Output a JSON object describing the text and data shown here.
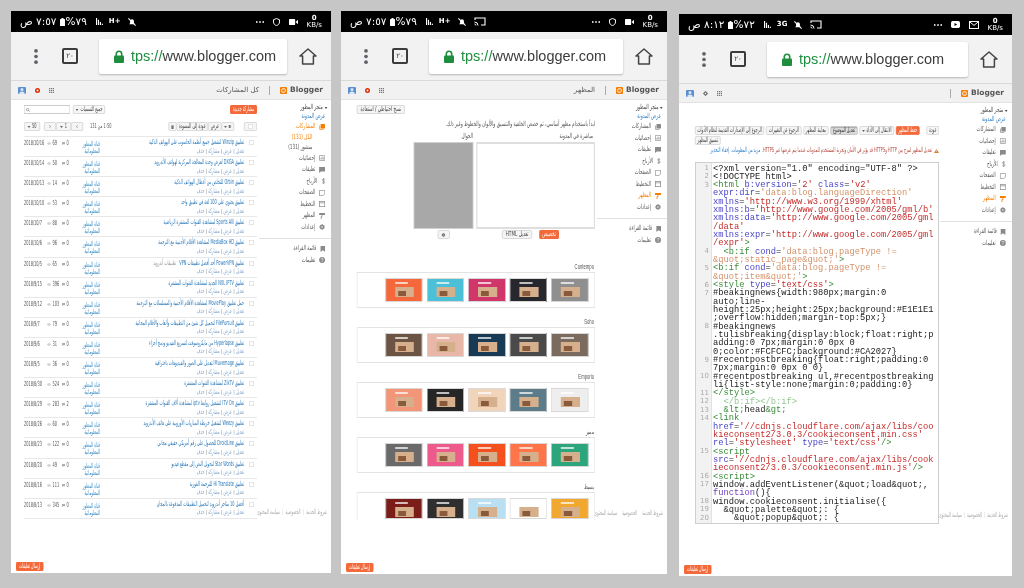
{
  "screens": [
    {
      "kind": "html_editor",
      "status_bar": {
        "time": "٨:١٢ ص",
        "battery": "%٧٢",
        "network": "3G",
        "icons": [
          {
            "kind": "cast"
          },
          {
            "kind": "mute"
          }
        ],
        "notifications": [
          {
            "kind": "mail"
          },
          {
            "kind": "play"
          },
          {
            "kind": "more"
          }
        ],
        "speed": "0",
        "speed_unit": "KB/s"
      },
      "browser": {
        "tab_count": "٢٠",
        "url_scheme": "tps://",
        "url_host": "www.blogger.com"
      },
      "app_header": {
        "brand": "Blogger",
        "account_icons": [
          {
            "kind": "apps"
          },
          {
            "kind": "settings"
          },
          {
            "kind": "avatar"
          }
        ]
      },
      "sidebar": {
        "blog_name": "متجر المطور",
        "view_blog": "عرض المدونة",
        "items": [
          {
            "label": "المشاركات",
            "selected": false
          },
          {
            "label": "إحصائيات",
            "selected": false
          },
          {
            "label": "تعليقات",
            "selected": false
          },
          {
            "label": "الأرباح",
            "selected": false
          },
          {
            "label": "الصفحات",
            "selected": false
          },
          {
            "label": "التخطيط",
            "selected": false
          },
          {
            "label": "المظهر",
            "selected": true
          },
          {
            "label": "إعدادات",
            "selected": false
          }
        ],
        "secondary_items": [
          "قائمة القراءة",
          "تعليمات"
        ]
      },
      "editor": {
        "toolbar_rows": [
          [
            {
              "label": "عودة",
              "kind": "default"
            },
            {
              "label": "حفظ المظهر",
              "kind": "primary"
            },
            {
              "label": "الانتقال إلى الأداة",
              "kind": "dropdown"
            },
            {
              "label": "تعديل الموضوع",
              "kind": "pressed"
            },
            {
              "label": "معاينة المظهر",
              "kind": "default"
            },
            {
              "label": "الرجوع عن التغييرات",
              "kind": "default"
            },
            {
              "label": "الرجوع إلى الإصدارات القديمة لنظام الأدوات",
              "kind": "default"
            }
          ],
          [
            {
              "label": "تنسيق المظهر",
              "kind": "default"
            }
          ]
        ],
        "warning": {
          "text": "تعديل المظهر لمزج بين HTTP وHTTPS قد يؤثر في الأمان وتجربة المستخدم للمدونات عندما يتم عرضها عبر HTTPS.",
          "links": [
            "مزيد من المعلومات.",
            "إخفاء التحذير"
          ]
        },
        "code_lines": [
          {
            "number": "1",
            "kind": "plain",
            "text": "<?xml version=\"1.0\" encoding=\"UTF-8\" ?>"
          },
          {
            "number": "2",
            "kind": "plain",
            "text": "<!DOCTYPE html>"
          },
          {
            "number": "3",
            "kind": "markup",
            "text": "<html b:version='2' class='v2' expr:dir='data:blog.languageDirection' xmlns='http://www.w3.org/1999/xhtml' xmlns:b='http://www.google.com/2005/gml/b' xmlns:data='http://www.google.com/2005/gml/data' xmlns:expr='http://www.google.com/2005/gml/expr'>"
          },
          {
            "number": "4",
            "kind": "markup",
            "text": "  <b:if cond='data:blog.pageType != &quot;static_page&quot;'>"
          },
          {
            "number": "5",
            "kind": "markup",
            "text": "<b:if cond='data:blog.pageType != &quot;item&quot;'>"
          },
          {
            "number": "6",
            "kind": "markup",
            "text": "<style type='text/css'>"
          },
          {
            "number": "7",
            "kind": "plain",
            "text": "#beakingnews{width:980px;margin:0 auto;line-height:25px;height:25px;background:#E1E1E1;overflow:hidden;margin-top:5px;}"
          },
          {
            "number": "8",
            "kind": "plain",
            "text": "#beakingnews .tulisbreaking{display:block;float:right;padding:0 7px;margin:0 0px 0 0;color:#FCFCFC;background:#CA2027}"
          },
          {
            "number": "9",
            "kind": "plain",
            "text": "#recentpostbreaking{float:right;padding:0 7px;margin:0 0px 0 0}"
          },
          {
            "number": "10",
            "kind": "plain",
            "text": "#recentpostbreaking ul,#recentpostbreaking li{list-style:none;margin:0;padding:0}"
          },
          {
            "number": "11",
            "kind": "markup",
            "text": "</style>"
          },
          {
            "number": "12",
            "kind": "dim",
            "text": "  </b:if></b:if>"
          },
          {
            "number": "13",
            "kind": "markup",
            "text": "  &lt;head&gt;"
          },
          {
            "number": "14",
            "kind": "markup",
            "text": "<link href='//cdnjs.cloudflare.com/ajax/libs/cookieconsent2/3.0.3/cookieconsent.min.css' rel='stylesheet' type='text/css'/>"
          },
          {
            "number": "15",
            "kind": "markup",
            "text": "<script src='//cdnjs.cloudflare.com/ajax/libs/cookieconsent2/3.0.3/cookieconsent.min.js'/>"
          },
          {
            "number": "16",
            "kind": "markup",
            "text": "<script>"
          },
          {
            "number": "17",
            "kind": "script",
            "text": "window.addEventListener(&quot;load&quot;, function(){"
          },
          {
            "number": "18",
            "kind": "plain",
            "text": "window.cookieconsent.initialise({"
          },
          {
            "number": "19",
            "kind": "plain",
            "text": "  &quot;palette&quot;: {"
          },
          {
            "number": "20",
            "kind": "plain",
            "text": "    &quot;popup&quot;: {"
          }
        ]
      },
      "footer_links": [
        "شروط الخدمة",
        "الخصوصية",
        "سياسة المحتوى"
      ],
      "feedback_button": "إرسال تعليقات"
    },
    {
      "kind": "theme",
      "status_bar": {
        "time": "٧:٥٧ ص",
        "battery": "%٧٩",
        "network": "H+",
        "icons": [
          {
            "kind": "cast"
          },
          {
            "kind": "mute"
          }
        ],
        "notifications": [
          {
            "kind": "video"
          },
          {
            "kind": "shield"
          },
          {
            "kind": "more"
          }
        ],
        "speed": "0",
        "speed_unit": "KB/s"
      },
      "browser": {
        "tab_count": "٢٠",
        "url_scheme": "tps://",
        "url_host": "www.blogger.com"
      },
      "app_header": {
        "brand": "Blogger",
        "page_title": "المظهر",
        "account_icons": [
          {
            "kind": "apps"
          },
          {
            "kind": "alert"
          },
          {
            "kind": "avatar"
          }
        ]
      },
      "sidebar": {
        "blog_name": "متجر المطور",
        "view_blog": "عرض المدونة",
        "items": [
          {
            "label": "المشاركات",
            "selected": false
          },
          {
            "label": "إحصائيات",
            "selected": false
          },
          {
            "label": "تعليقات",
            "selected": false
          },
          {
            "label": "الأرباح",
            "selected": false
          },
          {
            "label": "الصفحات",
            "selected": false
          },
          {
            "label": "التخطيط",
            "selected": false
          },
          {
            "label": "المظهر",
            "selected": true
          },
          {
            "label": "إعدادات",
            "selected": false
          }
        ],
        "secondary_items": [
          "قائمة القراءة",
          "تعليمات"
        ]
      },
      "theme": {
        "backup_button": "نسخ احتياطي / استعادة",
        "intro": "ابدأ باستخدام مظهر أساسي، ثم خصص الخلفية والتنسيق والألوان والخطوط وغير ذلك.",
        "live_label": "مباشرة في المدونة",
        "mobile_label": "الجوال",
        "customize_button": "تخصيص",
        "edit_html_button": "تعديل HTML",
        "groups": [
          {
            "name": "Contempo",
            "thumbnails": [
              {
                "color": "#8f8f8f"
              },
              {
                "color": "#27272e"
              },
              {
                "color": "#d1366b"
              },
              {
                "color": "#4cc0d6"
              },
              {
                "color": "#f4683c"
              }
            ]
          },
          {
            "name": "Soho",
            "thumbnails": [
              {
                "color": "#7b6a5e"
              },
              {
                "color": "#4a4a4a"
              },
              {
                "color": "#183a55"
              },
              {
                "color": "#e8b7a8"
              },
              {
                "color": "#6b5444"
              }
            ]
          },
          {
            "name": "Emporio",
            "thumbnails": [
              {
                "color": "#eeeeee"
              },
              {
                "color": "#5d7c8a"
              },
              {
                "color": "#f0d5bb"
              },
              {
                "color": "#262626"
              },
              {
                "color": "#f29578"
              }
            ]
          },
          {
            "name": "مميز",
            "thumbnails": [
              {
                "color": "#2ca57c"
              },
              {
                "color": "#ff7448"
              },
              {
                "color": "#f4511e"
              },
              {
                "color": "#ef5a8d"
              },
              {
                "color": "#6a6a6a"
              }
            ]
          },
          {
            "name": "بسيط",
            "thumbnails": [
              {
                "color": "#f0a830"
              },
              {
                "color": "#ffffff"
              },
              {
                "color": "#b9dff2"
              },
              {
                "color": "#2f2f2f"
              },
              {
                "color": "#7b1e1a"
              }
            ]
          }
        ]
      },
      "footer_links": [
        "شروط الخدمة",
        "الخصوصية",
        "سياسة المحتوى"
      ],
      "feedback_button": "إرسال تعليقات"
    },
    {
      "kind": "posts",
      "status_bar": {
        "time": "٧:٥٧ ص",
        "battery": "%٧٩",
        "network": "H+",
        "icons": [
          {
            "kind": "mute"
          }
        ],
        "notifications": [
          {
            "kind": "video"
          },
          {
            "kind": "shield"
          },
          {
            "kind": "more"
          }
        ],
        "speed": "0",
        "speed_unit": "KB/s"
      },
      "browser": {
        "tab_count": "٢٠",
        "url_scheme": "tps://",
        "url_host": "www.blogger.com"
      },
      "app_header": {
        "brand": "Blogger",
        "page_title": "كل المشاركات",
        "account_icons": [
          {
            "kind": "apps"
          },
          {
            "kind": "alert"
          },
          {
            "kind": "avatar"
          }
        ]
      },
      "sidebar": {
        "blog_name": "متجر المطور",
        "view_blog": "عرض المدونة",
        "items": [
          {
            "label": "المشاركات",
            "selected": true,
            "children": [
              {
                "label": "الكل (131)",
                "selected": true
              },
              {
                "label": "منشور (131)",
                "selected": false
              }
            ]
          },
          {
            "label": "إحصائيات",
            "selected": false
          },
          {
            "label": "تعليقات",
            "selected": false
          },
          {
            "label": "الأرباح",
            "selected": false
          },
          {
            "label": "الصفحات",
            "selected": false
          },
          {
            "label": "التخطيط",
            "selected": false
          },
          {
            "label": "المظهر",
            "selected": false
          },
          {
            "label": "إعدادات",
            "selected": false
          }
        ],
        "secondary_items": [
          "قائمة القراءة",
          "تعليمات"
        ]
      },
      "posts": {
        "new_post_button": "مشاركة جديدة",
        "label_filter": "جميع التسميات",
        "select_all_checked": false,
        "actions": [
          "عرض",
          "عودة إلى المسودة"
        ],
        "range": "1-50 من 131",
        "page": "1",
        "page_size": "50",
        "rows": [
          {
            "checked": false,
            "title": "تطبيق Winzip لتشغيل جميع أنظمة الحاسوب على الهواتف الذكية",
            "actions": [
              "تعديل",
              "عرض",
              "مشاركة",
              "حذف"
            ],
            "author": "قناة المطور المعلوماتية",
            "comments": "0",
            "views": "69",
            "date": "2018/10/16"
          },
          {
            "checked": false,
            "title": "تطبيق DXGA لعرض وحدة المعالجة المركزية لهواتف الأندرويد",
            "actions": [
              "تعديل",
              "عرض",
              "مشاركة",
              "حذف"
            ],
            "author": "قناة المطور المعلوماتية",
            "comments": "0",
            "views": "50",
            "date": "2018/10/14"
          },
          {
            "checked": false,
            "title": "تطبيق Orbin للتخلص من أعطال الهواتف الذكية",
            "actions": [
              "تعديل",
              "عرض",
              "مشاركة",
              "حذف"
            ],
            "author": "قناة المطور المعلوماتية",
            "comments": "0",
            "views": "14",
            "date": "2018/10/13"
          },
          {
            "checked": false,
            "title": "تطبيق يحتوي على 100 لغة في تطبيق واحد",
            "actions": [
              "تعديل",
              "عرض",
              "مشاركة",
              "حذف"
            ],
            "author": "قناة المطور المعلوماتية",
            "comments": "0",
            "views": "53",
            "date": "2018/10/10"
          },
          {
            "checked": false,
            "title": "تطبيق Sports Alli لمشاهدة القنوات المشفرة الرياضية",
            "actions": [
              "تعديل",
              "عرض",
              "مشاركة",
              "حذف"
            ],
            "author": "قناة المطور المعلوماتية",
            "comments": "0",
            "views": "88",
            "date": "2018/10/7"
          },
          {
            "checked": false,
            "title": "تطبيق MediaBox HD لمشاهدة الأفلام الأجنبية مع الترجمة",
            "actions": [
              "تعديل",
              "عرض",
              "مشاركة",
              "حذف"
            ],
            "author": "قناة المطور المعلوماتية",
            "comments": "0",
            "views": "96",
            "date": "2018/10/6"
          },
          {
            "checked": false,
            "title": "تطبيق PowerVPN أحد أفضل تطبيقات VPN",
            "label": "تطبيقات أندرويد",
            "actions": [
              "تعديل",
              "عرض",
              "مشاركة",
              "حذف"
            ],
            "author": "قناة المطور المعلوماتية",
            "comments": "0",
            "views": "65",
            "date": "2018/10/5"
          },
          {
            "checked": false,
            "title": "تطبيق NXL IPTV الجديد لمشاهدة القنوات المشفرة",
            "actions": [
              "تعديل",
              "عرض",
              "مشاركة",
              "حذف"
            ],
            "author": "قناة المطور المعلوماتية",
            "comments": "0",
            "views": "396",
            "date": "2018/9/15"
          },
          {
            "checked": false,
            "title": "حمل تطبيق MoviePlay لمشاهدة الأفلام الأجنبية والمسلسلات مع الترجمة",
            "actions": [
              "تعديل",
              "عرض",
              "مشاركة",
              "حذف"
            ],
            "author": "قناة المطور المعلوماتية",
            "comments": "0",
            "views": "103",
            "date": "2018/9/12"
          },
          {
            "checked": false,
            "title": "تطبيق FilePursuit لتحميل كل شيئ من التطبيقات وألعاب والأفلام المجانية",
            "actions": [
              "تعديل",
              "عرض",
              "مشاركة",
              "حذف"
            ],
            "author": "قناة المطور المعلوماتية",
            "comments": "0",
            "views": "79",
            "date": "2018/9/7"
          },
          {
            "checked": false,
            "title": "تطبيق Hyperlapse من مايكروسوفت لتسريع الفيديو ودمج أجزاء",
            "actions": [
              "تعديل",
              "عرض",
              "مشاركة",
              "حذف"
            ],
            "author": "قناة المطور المعلوماتية",
            "comments": "0",
            "views": "31",
            "date": "2018/9/6"
          },
          {
            "checked": false,
            "title": "تطبيق Muvemage لتعديل على الصور والفيديوهات باحترافية",
            "actions": [
              "تعديل",
              "عرض",
              "مشاركة",
              "حذف"
            ],
            "author": "قناة المطور المعلوماتية",
            "comments": "0",
            "views": "36",
            "date": "2018/9/5"
          },
          {
            "checked": false,
            "title": "تطبيق ZikTV لمشاهدة القنوات المشفرة",
            "actions": [
              "تعديل",
              "عرض",
              "مشاركة",
              "حذف"
            ],
            "author": "قناة المطور المعلوماتية",
            "comments": "0",
            "views": "524",
            "date": "2018/8/30"
          },
          {
            "checked": false,
            "title": "تطبيق ITV On لتشغيل روابط iptv لمشاهدة آلاف القنوات المشفرة",
            "actions": [
              "تعديل",
              "عرض",
              "مشاركة",
              "حذف"
            ],
            "author": "قناة المطور المعلوماتية",
            "comments": "2",
            "views": "283",
            "date": "2018/8/29"
          },
          {
            "checked": false,
            "title": "تطبيق Weezy لتشغيل خريطة المباريات الأوروبية على هاتف الأندرويد",
            "actions": [
              "تعديل",
              "عرض",
              "مشاركة",
              "حذف"
            ],
            "author": "قناة المطور المعلوماتية",
            "comments": "0",
            "views": "60",
            "date": "2018/8/26"
          },
          {
            "checked": false,
            "title": "تطبيق DroidLine للحصول على رقم أمريكي حقيقي مجاني",
            "actions": [
              "تعديل",
              "عرض",
              "مشاركة",
              "حذف"
            ],
            "author": "قناة المطور المعلوماتية",
            "comments": "0",
            "views": "122",
            "date": "2018/8/23"
          },
          {
            "checked": false,
            "title": "تطبيق Star Words لتحويل النص إلى مقطع فيديو",
            "actions": [
              "تعديل",
              "عرض",
              "مشاركة",
              "حذف"
            ],
            "author": "قناة المطور المعلوماتية",
            "comments": "0",
            "views": "49",
            "date": "2018/8/20"
          },
          {
            "checked": false,
            "title": "تطبيق Hi Translate للترجمة الفورية",
            "actions": [
              "تعديل",
              "عرض",
              "مشاركة",
              "حذف"
            ],
            "author": "قناة المطور المعلوماتية",
            "comments": "0",
            "views": "111",
            "date": "2018/8/16"
          },
          {
            "checked": false,
            "title": "أفضل 10 متاجر أندرويد لتحميل التطبيقات المدفوعة بالمجان",
            "actions": [
              "تعديل",
              "عرض",
              "مشاركة",
              "حذف"
            ],
            "author": "قناة المطور المعلوماتية",
            "comments": "0",
            "views": "345",
            "date": "2018/8/13"
          }
        ]
      },
      "footer_links": [
        "شروط الخدمة",
        "الخصوصية",
        "سياسة المحتوى"
      ],
      "feedback_button": "إرسال تعليقات"
    }
  ]
}
